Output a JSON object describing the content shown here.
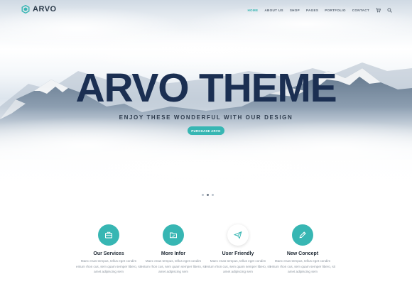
{
  "brand": {
    "name": "ARVO",
    "logo_icon": "hexagon-logo-icon",
    "accent": "#37b6b3"
  },
  "nav": {
    "items": [
      {
        "label": "HOME",
        "active": true
      },
      {
        "label": "ABOUT US",
        "active": false
      },
      {
        "label": "SHOP",
        "active": false
      },
      {
        "label": "PAGES",
        "active": false
      },
      {
        "label": "PORTFOLIO",
        "active": false
      },
      {
        "label": "CONTACT",
        "active": false
      }
    ],
    "icons": [
      "cart-icon",
      "search-icon"
    ]
  },
  "hero": {
    "title": "ARVO THEME",
    "subtitle": "ENJOY THESE WONDERFUL WITH OUR DESIGN",
    "button_label": "PURCHASE ARVO",
    "slides": 3,
    "active_slide": 2
  },
  "features": [
    {
      "title": "Our Services",
      "icon": "briefcase-icon",
      "style": "teal",
      "text": "Maec enas tempus, tellus eget condim entum rhon cus, sem quam semper libero, sit amet adipiscing sem"
    },
    {
      "title": "More Infor",
      "icon": "folder-icon",
      "style": "teal",
      "text": "Maec enas tempus, tellus eget condim entum rhon cus, sem quam semper libero, sit amet adipiscing sem"
    },
    {
      "title": "User Friendly",
      "icon": "paper-plane-icon",
      "style": "white",
      "text": "Maec enas tempus, tellus eget condim entum rhon cus, sem quam semper libero, sit amet adipiscing sem"
    },
    {
      "title": "New Concept",
      "icon": "pencil-icon",
      "style": "teal",
      "text": "Maec enas tempus, tellus eget condim entum rhon cus, sem quam semper libero, sit amet adipiscing sem"
    }
  ]
}
